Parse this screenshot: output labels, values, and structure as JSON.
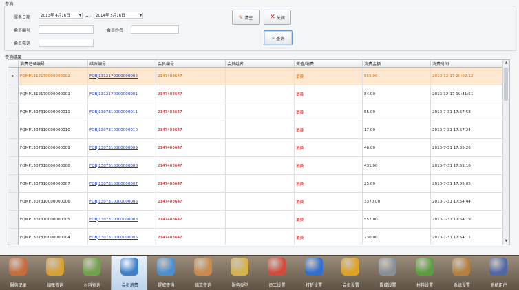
{
  "query_section": {
    "title": "查询",
    "service_date_label": "服务日期",
    "date_from": "2013年 4月16日",
    "range_separator": "～",
    "date_to": "2014年 5月16日",
    "member_no_label": "会员编号",
    "member_no_value": "",
    "member_name_label": "会员姓名",
    "member_name_value": "",
    "member_phone_label": "会员电话",
    "member_phone_value": "",
    "clear_label": "清空",
    "close_label": "关闭",
    "search_label": "查询"
  },
  "results_section": {
    "title": "查询结果",
    "columns": [
      "消费记录编号",
      "结账编号",
      "会员编号",
      "会员姓名",
      "充值/消费",
      "消费金额",
      "消费时间"
    ],
    "selected_row": 0,
    "rows": [
      {
        "record_no": "FQMP1312170000000002",
        "bill_no": "FQBJ1312170000000002",
        "member_no": "2147483647",
        "member_name": "",
        "type": "消费",
        "amount": "555.00",
        "time": "2013-12-17 20:02:12"
      },
      {
        "record_no": "FQMP1312170000000001",
        "bill_no": "FQBJ1312170000000001",
        "member_no": "2147483647",
        "member_name": "",
        "type": "消费",
        "amount": "84.00",
        "time": "2013-12-17 19:41:51"
      },
      {
        "record_no": "FQMP1307310000000011",
        "bill_no": "FQBJ1307310000000011",
        "member_no": "2147483647",
        "member_name": "",
        "type": "消费",
        "amount": "55.00",
        "time": "2013-7-31 17:57:58"
      },
      {
        "record_no": "FQMP1307310000000010",
        "bill_no": "FQBJ1307310000000010",
        "member_no": "2147483647",
        "member_name": "",
        "type": "消费",
        "amount": "17.00",
        "time": "2013-7-31 17:57:24"
      },
      {
        "record_no": "FQMP1307310000000009",
        "bill_no": "FQBJ1307310000000009",
        "member_no": "2147483647",
        "member_name": "",
        "type": "消费",
        "amount": "46.00",
        "time": "2013-7-31 17:55:26"
      },
      {
        "record_no": "FQMP1307310000000008",
        "bill_no": "FQBJ1307310000000008",
        "member_no": "2147483647",
        "member_name": "",
        "type": "消费",
        "amount": "431.00",
        "time": "2013-7-31 17:55:16"
      },
      {
        "record_no": "FQMP1307310000000007",
        "bill_no": "FQBJ1307310000000007",
        "member_no": "2147483647",
        "member_name": "",
        "type": "消费",
        "amount": "25.00",
        "time": "2013-7-31 17:55:05"
      },
      {
        "record_no": "FQMP1307310000000006",
        "bill_no": "FQBJ1307310000000006",
        "member_no": "2147483647",
        "member_name": "",
        "type": "消费",
        "amount": "3370.00",
        "time": "2013-7-31 17:54:44"
      },
      {
        "record_no": "FQMP1307310000000005",
        "bill_no": "FQBJ1307310000000003",
        "member_no": "2147483647",
        "member_name": "",
        "type": "消费",
        "amount": "557.00",
        "time": "2013-7-31 17:54:19"
      },
      {
        "record_no": "FQMP1307310000000004",
        "bill_no": "FQBJ1307310000000005",
        "member_no": "2147483647",
        "member_name": "",
        "type": "消费",
        "amount": "230.00",
        "time": "2013-7-31 17:54:11"
      },
      {
        "record_no": "FQMP1307310000000003",
        "bill_no": "FQBJ1307300000000001",
        "member_no": "2147483647",
        "member_name": "",
        "type": "消费",
        "amount": "225.00",
        "time": "2013-7-31 16:49:51"
      },
      {
        "record_no": "FQMP1307310000000002",
        "bill_no": "FQBJ1307310000000002",
        "member_no": "2147483647",
        "member_name": "",
        "type": "消费",
        "amount": "355.00",
        "time": "2013-7-31 16:49:34"
      }
    ]
  },
  "toolbar": {
    "active_index": 3,
    "items": [
      {
        "label": "服务记录",
        "icon": "service-record-icon",
        "color": "#c96b3b"
      },
      {
        "label": "结账查询",
        "icon": "checkout-query-icon",
        "color": "#d9a032"
      },
      {
        "label": "材料查询",
        "icon": "material-query-icon",
        "color": "#6fa24a"
      },
      {
        "label": "会员消费",
        "icon": "member-consume-icon",
        "color": "#3e7fc8"
      },
      {
        "label": "提成查询",
        "icon": "commission-query-icon",
        "color": "#4a8fd0"
      },
      {
        "label": "结算查询",
        "icon": "settlement-query-icon",
        "color": "#c98a4a"
      },
      {
        "label": "服务类型",
        "icon": "service-type-icon",
        "color": "#d6b24a"
      },
      {
        "label": "员工设置",
        "icon": "staff-settings-icon",
        "color": "#d24b3a"
      },
      {
        "label": "打折设置",
        "icon": "discount-settings-icon",
        "color": "#2f6fd0"
      },
      {
        "label": "会员设置",
        "icon": "member-settings-icon",
        "color": "#e0a21e"
      },
      {
        "label": "提成设置",
        "icon": "commission-settings-icon",
        "color": "#8a8f96"
      },
      {
        "label": "材料设置",
        "icon": "material-settings-icon",
        "color": "#5a9e3e"
      },
      {
        "label": "系统设置",
        "icon": "system-settings-icon",
        "color": "#b5803e"
      },
      {
        "label": "系统用户",
        "icon": "system-user-icon",
        "color": "#5068a8"
      }
    ]
  }
}
